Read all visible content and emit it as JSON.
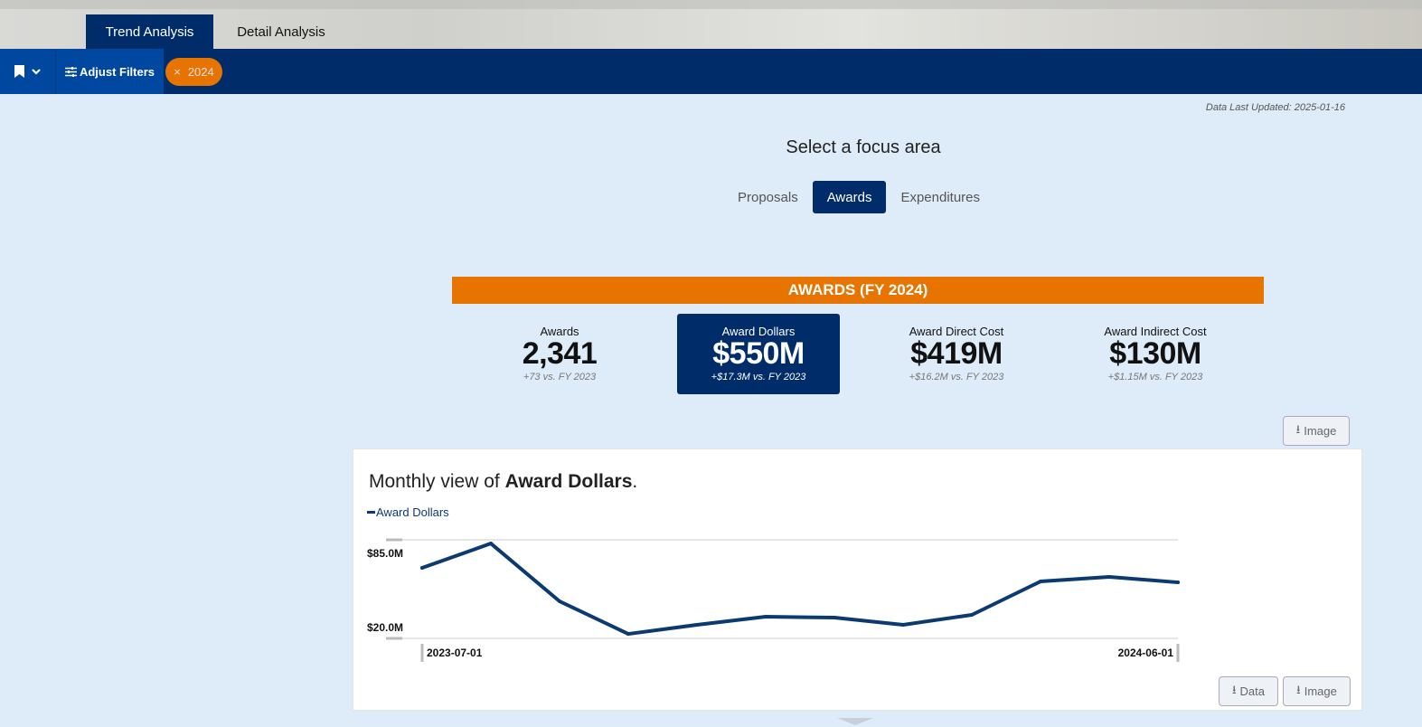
{
  "tabs": [
    {
      "label": "Trend Analysis",
      "active": true
    },
    {
      "label": "Detail Analysis",
      "active": false
    }
  ],
  "toolbar": {
    "bookmark_icon": "bookmark-icon",
    "adjust_filters": "Adjust Filters",
    "filter_chip": {
      "remove": "×",
      "label": "2024"
    }
  },
  "data_last_updated": "Data Last Updated: 2025-01-16",
  "focus": {
    "title": "Select a focus area",
    "options": [
      "Proposals",
      "Awards",
      "Expenditures"
    ],
    "selected": "Awards"
  },
  "banner": "AWARDS (FY 2024)",
  "kpis": [
    {
      "label": "Awards",
      "value": "2,341",
      "delta": "+73 vs. FY 2023"
    },
    {
      "label": "Award Dollars",
      "value": "$550M",
      "delta": "+$17.3M vs. FY 2023",
      "selected": true
    },
    {
      "label": "Award Direct Cost",
      "value": "$419M",
      "delta": "+$16.2M vs. FY 2023"
    },
    {
      "label": "Award Indirect Cost",
      "value": "$130M",
      "delta": "+$1.15M vs. FY 2023"
    }
  ],
  "buttons": {
    "image": "Image",
    "data": "Data"
  },
  "chart": {
    "title_prefix": "Monthly view of ",
    "title_bold": "Award Dollars",
    "title_suffix": "."
  },
  "colors": {
    "navy": "#002d6a",
    "orange": "#e87400",
    "line": "#0b3a70"
  },
  "chart_data": {
    "type": "line",
    "legend": "Award Dollars",
    "x": [
      "2023-07-01",
      "2023-08-01",
      "2023-09-01",
      "2023-10-01",
      "2023-11-01",
      "2023-12-01",
      "2024-01-01",
      "2024-02-01",
      "2024-03-01",
      "2024-04-01",
      "2024-05-01",
      "2024-06-01"
    ],
    "series": [
      {
        "name": "Award Dollars",
        "values": [
          72.3,
          93.7,
          43.0,
          14.4,
          22.4,
          29.5,
          28.7,
          22.4,
          31.1,
          60.4,
          64.4,
          59.6
        ]
      }
    ],
    "y_ticks": [
      "$85.0M",
      "$20.0M"
    ],
    "x_ticks": [
      "2023-07-01",
      "2024-06-01"
    ],
    "ylim": [
      10.5,
      96.9
    ],
    "unit": "$M"
  }
}
